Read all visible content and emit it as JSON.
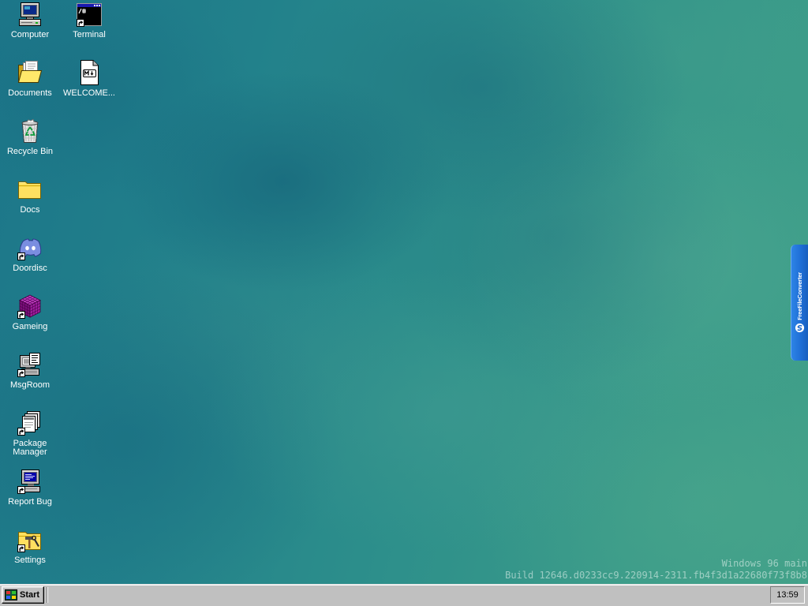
{
  "desktop": {
    "icons": [
      {
        "label": "Computer",
        "icon": "computer-icon",
        "shortcut": false
      },
      {
        "label": "Documents",
        "icon": "documents-folder-icon",
        "shortcut": false
      },
      {
        "label": "Recycle Bin",
        "icon": "recycle-bin-icon",
        "shortcut": false
      },
      {
        "label": "Docs",
        "icon": "folder-icon",
        "shortcut": false
      },
      {
        "label": "Doordisc",
        "icon": "discord-icon",
        "shortcut": true
      },
      {
        "label": "Gameing",
        "icon": "game-cube-icon",
        "shortcut": true
      },
      {
        "label": "MsgRoom",
        "icon": "msgroom-icon",
        "shortcut": true
      },
      {
        "label": "Package Manager",
        "icon": "package-manager-icon",
        "shortcut": true
      },
      {
        "label": "Report Bug",
        "icon": "report-bug-icon",
        "shortcut": true
      },
      {
        "label": "Settings",
        "icon": "settings-folder-icon",
        "shortcut": true
      },
      {
        "label": "Terminal",
        "icon": "terminal-icon",
        "shortcut": true
      },
      {
        "label": "WELCOME...",
        "icon": "markdown-file-icon",
        "shortcut": false
      }
    ]
  },
  "version": {
    "title": "Windows 96 main",
    "build": "Build 12646.d0233cc9.220914-2311.fb4f3d1a22680f73f8b8"
  },
  "side_tab": {
    "label": "FreeFileConverter",
    "icon": "freefileconverter-logo-icon"
  },
  "taskbar": {
    "start_label": "Start",
    "start_icon": "windows96-logo-icon",
    "clock": "13:59"
  },
  "colors": {
    "desktop": "#2a8a8a",
    "taskbar": "#c0c0c0",
    "icon_label": "#ffffff",
    "side_tab": "#1f6fd6"
  }
}
